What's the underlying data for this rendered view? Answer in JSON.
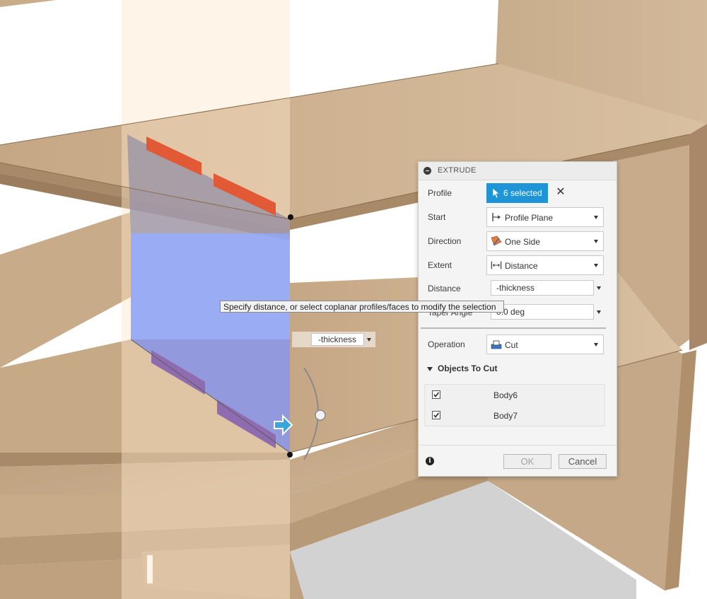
{
  "panel": {
    "title": "EXTRUDE",
    "profile": {
      "label": "Profile",
      "value": "6 selected",
      "clear_glyph": "✕"
    },
    "start": {
      "label": "Start",
      "value": "Profile Plane",
      "icon": "profile-plane-icon"
    },
    "direction": {
      "label": "Direction",
      "value": "One Side",
      "icon": "one-side-icon"
    },
    "extent": {
      "label": "Extent",
      "value": "Distance",
      "icon": "distance-icon"
    },
    "distance": {
      "label": "Distance",
      "value": "-thickness"
    },
    "taper": {
      "label": "Taper Angle",
      "value": "0.0 deg"
    },
    "operation": {
      "label": "Operation",
      "value": "Cut",
      "icon": "cut-icon"
    },
    "objects_to_cut": {
      "title": "Objects To Cut",
      "items": [
        {
          "name": "Body6",
          "checked": true
        },
        {
          "name": "Body7",
          "checked": true
        }
      ]
    },
    "buttons": {
      "ok": "OK",
      "cancel": "Cancel"
    },
    "info_glyph": "i"
  },
  "tooltip": "Specify distance, or select coplanar profiles/faces to modify the selection",
  "viewport_input": {
    "value": "-thickness"
  },
  "colors": {
    "accent": "#1f95d8",
    "wood": "#c9ad8a",
    "selection_blue": "#8aa2f2",
    "cut_red": "#e0502a"
  }
}
